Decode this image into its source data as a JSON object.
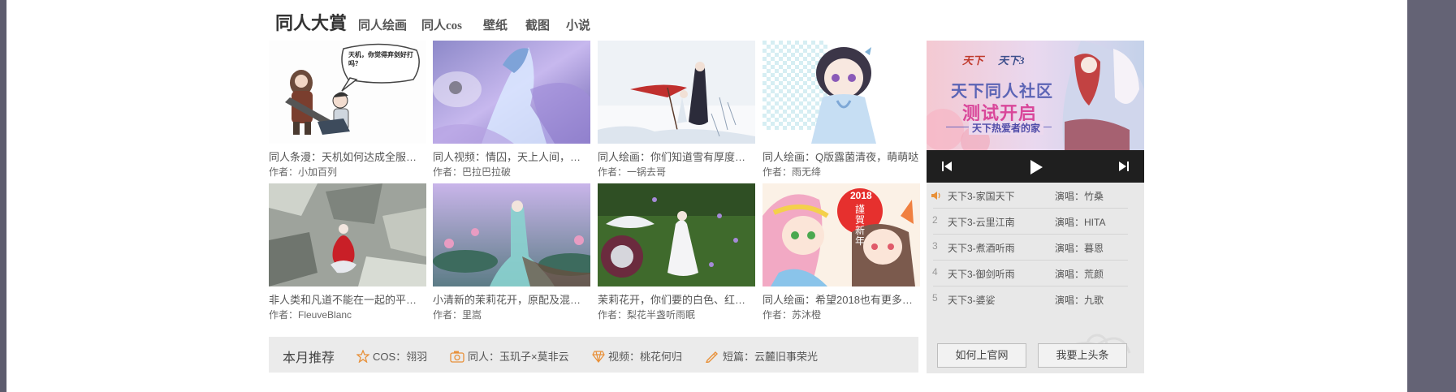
{
  "tabs": {
    "main": "同人大賞",
    "items": [
      "同人绘画",
      "同人cos",
      "壁纸",
      "截图",
      "小说"
    ]
  },
  "comic_bubble": "天机，你觉得弃剑好打吗？",
  "grid": [
    {
      "caption": "同人条漫：天机如何达成全服弃…",
      "author": "作者：小加百列"
    },
    {
      "caption": "同人视频：情囚，天上人间，一…",
      "author": "作者：巴拉巴拉破"
    },
    {
      "caption": "同人绘画：你们知道雪有厚度这…",
      "author": "作者：一锅去哥"
    },
    {
      "caption": "同人绘画：Q版露菌清夜，萌萌哒",
      "author": "作者：雨无绛"
    },
    {
      "caption": "非人类和凡道不能在一起的平凡…",
      "author": "作者：FleuveBlanc"
    },
    {
      "caption": "小清新的茉莉花开，原配及混搭…",
      "author": "作者：里嵩"
    },
    {
      "caption": "茉莉花开，你们要的白色、红色…",
      "author": "作者：梨花半盏听雨眠"
    },
    {
      "caption": "同人绘画：希望2018也有更多美…",
      "author": "作者：苏沐橙"
    }
  ],
  "newyear_card": {
    "year": "2018",
    "text": "謹賀新年"
  },
  "recommend": {
    "title": "本月推荐",
    "items": [
      {
        "label": "COS：翎羽",
        "icon": "star-icon"
      },
      {
        "label": "同人：玉玑子×莫非云",
        "icon": "camera-icon"
      },
      {
        "label": "视频：桃花何归",
        "icon": "diamond-icon"
      },
      {
        "label": "短篇：云麓旧事荣光",
        "icon": "pen-icon"
      }
    ]
  },
  "banner": {
    "logo1": "天下",
    "logo2": "天下3",
    "headline1": "天下同人社区",
    "headline2": "测试开启",
    "tagline": "天下热爱者的家"
  },
  "playlist": [
    {
      "num": "",
      "song": "天下3-家国天下",
      "singer": "演唱：竹桑"
    },
    {
      "num": "2",
      "song": "天下3-云里江南",
      "singer": "演唱：HITA"
    },
    {
      "num": "3",
      "song": "天下3-煮酒听雨",
      "singer": "演唱：暮恩"
    },
    {
      "num": "4",
      "song": "天下3-御剑听雨",
      "singer": "演唱：荒颜"
    },
    {
      "num": "5",
      "song": "天下3-婆娑",
      "singer": "演唱：九歌"
    }
  ],
  "buttons": {
    "howto": "如何上官网",
    "headline": "我要上头条"
  },
  "colors": {
    "accent": "#e8913a",
    "sidebar": "#5d5c6e",
    "player": "#1f1f1f"
  }
}
